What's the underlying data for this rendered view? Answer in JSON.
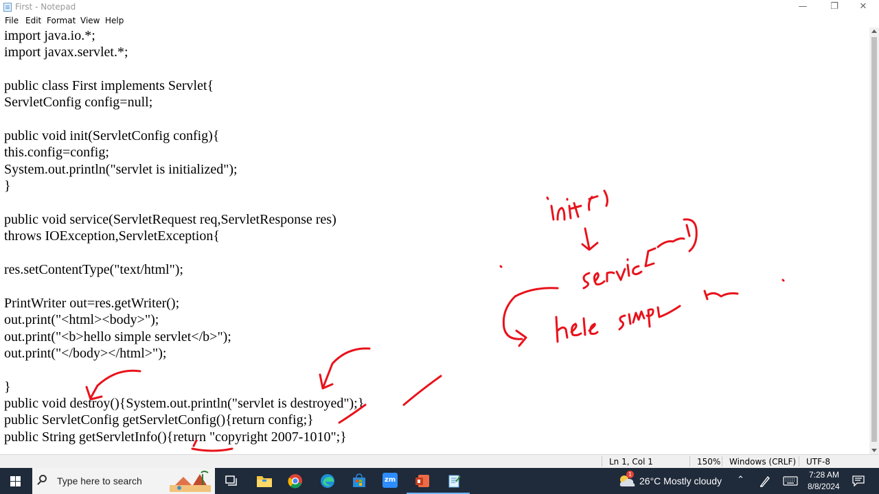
{
  "window": {
    "title": "First - Notepad",
    "minimize_glyph": "—",
    "maximize_glyph": "❐",
    "close_glyph": "✕"
  },
  "menu": [
    "File",
    "Edit",
    "Format",
    "View",
    "Help"
  ],
  "editor": {
    "lines": [
      "import java.io.*;",
      "import javax.servlet.*;",
      "",
      "public class First implements Servlet{",
      "ServletConfig config=null;",
      "",
      "public void init(ServletConfig config){",
      "this.config=config;",
      "System.out.println(\"servlet is initialized\");",
      "}",
      "",
      "public void service(ServletRequest req,ServletResponse res)",
      "throws IOException,ServletException{",
      "",
      "res.setContentType(\"text/html\");",
      "",
      "PrintWriter out=res.getWriter();",
      "out.print(\"<html><body>\");",
      "out.print(\"<b>hello simple servlet</b>\");",
      "out.print(\"</body></html>\");",
      "",
      "}",
      "public void destroy(){System.out.println(\"servlet is destroyed\");}",
      "public ServletConfig getServletConfig(){return config;}",
      "public String getServletInfo(){return \"copyright 2007-1010\";}"
    ]
  },
  "annotations": {
    "color": "#e8121b",
    "handwriting": [
      "init( )",
      "service[",
      "helo simpl"
    ]
  },
  "statusbar": {
    "position": "Ln 1, Col 1",
    "zoom": "150%",
    "line_ending": "Windows (CRLF)",
    "encoding": "UTF-8"
  },
  "taskbar": {
    "search_placeholder": "Type here to search",
    "weather": "26°C  Mostly cloudy",
    "weather_badge": "1",
    "time": "7:28 AM",
    "date": "8/8/2024",
    "zoom_label": "zm",
    "icons": [
      "task-view-icon",
      "file-explorer-icon",
      "chrome-icon",
      "edge-icon",
      "store-icon",
      "zoom-icon",
      "powerpoint-icon",
      "notepad-icon"
    ]
  },
  "colors": {
    "taskbar": "#1f2a3a",
    "accent": "#e8121b"
  }
}
